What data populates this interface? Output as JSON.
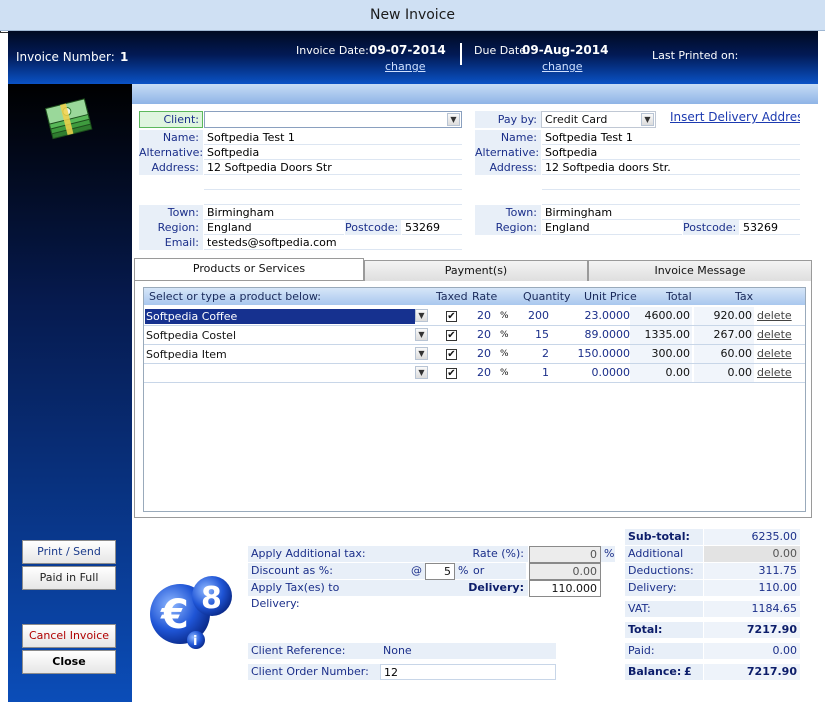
{
  "window": {
    "title": "New Invoice"
  },
  "header": {
    "invoice_number_label": "Invoice Number:",
    "invoice_number": "1",
    "invoice_date_label": "Invoice Date:",
    "invoice_date": "09-07-2014",
    "due_date_label": "Due Date:",
    "due_date": "09-Aug-2014",
    "change_label": "change",
    "last_printed_label": "Last Printed on:"
  },
  "client": {
    "client_label": "Client:",
    "client_value": "",
    "name_label": "Name:",
    "name": "Softpedia Test 1",
    "alt_label": "Alternative:",
    "alt": "Softpedia",
    "address_label": "Address:",
    "address1": "12 Softpedia Doors Str",
    "address2": "",
    "address3": "",
    "town_label": "Town:",
    "town": "Birmingham",
    "region_label": "Region:",
    "region": "England",
    "postcode_label": "Postcode:",
    "postcode": "53269",
    "email_label": "Email:",
    "email": "testeds@softpedia.com"
  },
  "delivery": {
    "payby_label": "Pay by:",
    "payby_value": "Credit Card",
    "insert_link": "Insert Delivery Address",
    "name_label": "Name:",
    "name": "Softpedia Test 1",
    "alt_label": "Alternative:",
    "alt": "Softpedia",
    "address_label": "Address:",
    "address1": "12 Softpedia doors Str.",
    "town_label": "Town:",
    "town": "Birmingham",
    "region_label": "Region:",
    "region": "England",
    "postcode_label": "Postcode:",
    "postcode": "53269"
  },
  "tabs": [
    "Products or Services",
    "Payment(s)",
    "Invoice Message"
  ],
  "grid": {
    "headers": {
      "product": "Select or type a product below:",
      "taxed": "Taxed",
      "rate": "Rate",
      "quantity": "Quantity",
      "unit_price": "Unit Price",
      "total": "Total",
      "tax": "Tax"
    },
    "percent": "%",
    "delete_label": "delete",
    "rows": [
      {
        "product": "Softpedia Coffee",
        "taxed": true,
        "rate": "20",
        "qty": "200",
        "unit": "23.0000",
        "total": "4600.00",
        "tax": "920.00"
      },
      {
        "product": "Softpedia Costel",
        "taxed": true,
        "rate": "20",
        "qty": "15",
        "unit": "89.0000",
        "total": "1335.00",
        "tax": "267.00"
      },
      {
        "product": "Softpedia Item",
        "taxed": true,
        "rate": "20",
        "qty": "2",
        "unit": "150.0000",
        "total": "300.00",
        "tax": "60.00"
      },
      {
        "product": "",
        "taxed": true,
        "rate": "20",
        "qty": "1",
        "unit": "0.0000",
        "total": "0.00",
        "tax": "0.00"
      }
    ]
  },
  "options": {
    "add_tax_label": "Apply Additional tax:",
    "rate_label": "Rate (%):",
    "rate_value": "0",
    "discount_label": "Discount as %:",
    "at_label": "@",
    "discount_value": "5",
    "percent": "%",
    "deduct_label": "or Deduct:",
    "deduct_value": "0.00",
    "apply_delivery_label": "Apply Tax(es) to Delivery:",
    "delivery_label": "Delivery:",
    "delivery_value": "110.000",
    "client_ref_label": "Client Reference:",
    "client_ref": "None",
    "client_order_label": "Client Order Number:",
    "client_order": "12"
  },
  "totals": {
    "subtotal_label": "Sub-total:",
    "subtotal": "6235.00",
    "addtax_label": "Additional Tax:",
    "addtax": "0.00",
    "deductions_label": "Deductions:",
    "deductions": "311.75",
    "delivery_label": "Delivery:",
    "delivery": "110.00",
    "vat_label": "VAT:",
    "vat": "1184.65",
    "total_label": "Total:",
    "total": "7217.90",
    "paid_label": "Paid:",
    "paid": "0.00",
    "balance_label": "Balance:",
    "currency": "£",
    "balance": "7217.90"
  },
  "buttons": {
    "print_send": "Print / Send",
    "paid_full": "Paid in Full",
    "cancel": "Cancel  Invoice",
    "close": "Close"
  },
  "colors": {
    "header_dark": "#021a55",
    "header_blue": "#0a52c6",
    "label_blue": "#1b2f8a",
    "field_bg": "#e8eff8",
    "cancel_red": "#b00000"
  }
}
